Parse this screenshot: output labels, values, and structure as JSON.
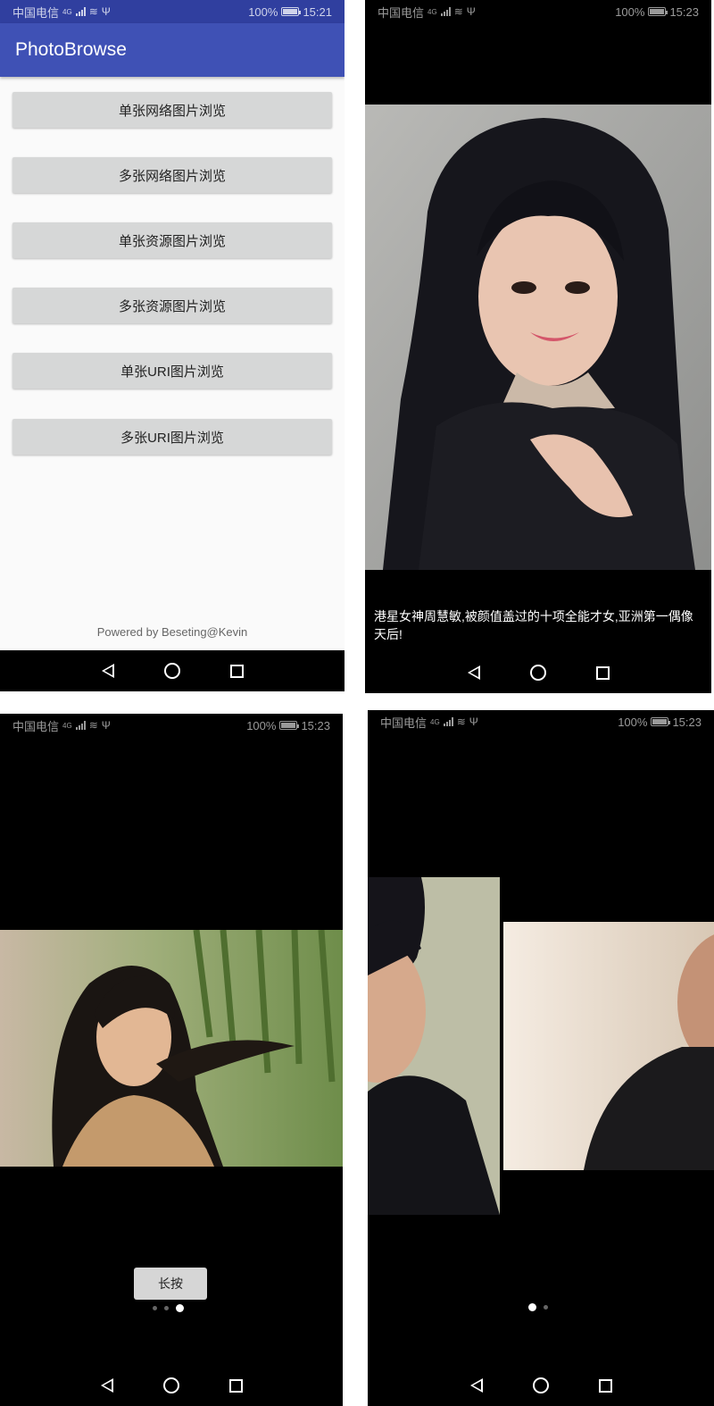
{
  "status_bar": {
    "carrier": "中国电信",
    "network": "4G",
    "battery": "100%",
    "time_screen1": "15:21",
    "time_other": "15:23"
  },
  "app": {
    "title": "PhotoBrowse",
    "buttons": [
      "单张网络图片浏览",
      "多张网络图片浏览",
      "单张资源图片浏览",
      "多张资源图片浏览",
      "单张URI图片浏览",
      "多张URI图片浏览"
    ],
    "footer": "Powered by Beseting@Kevin"
  },
  "viewer1": {
    "caption": "港星女神周慧敏,被颜值盖过的十项全能才女,亚洲第一偶像天后!"
  },
  "viewer2": {
    "long_press_label": "长按",
    "page_count": 3,
    "current_page": 3
  },
  "viewer3": {
    "page_count": 2,
    "current_page": 1
  },
  "colors": {
    "primary": "#3f51b5",
    "primary_dark": "#303f9f",
    "button_bg": "#d6d7d7",
    "viewer_bg": "#000000"
  },
  "icons": [
    "signal-icon",
    "wifi-icon",
    "usb-icon",
    "battery-icon",
    "nav-back-icon",
    "nav-home-icon",
    "nav-recent-icon"
  ]
}
